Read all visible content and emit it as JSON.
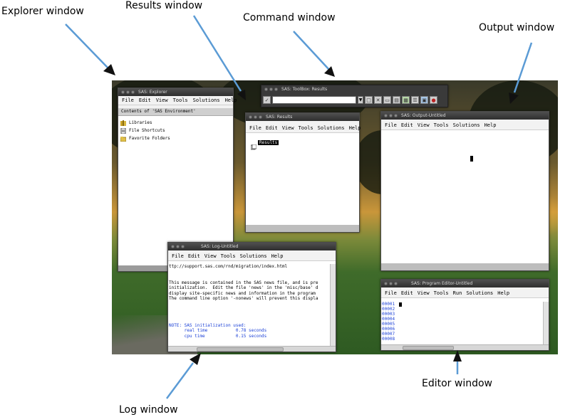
{
  "annotations": {
    "explorer": "Explorer window",
    "results": "Results window",
    "command": "Command window",
    "output": "Output window",
    "log": "Log window",
    "editor": "Editor window"
  },
  "explorer": {
    "title": "SAS: Explorer",
    "menu": [
      "File",
      "Edit",
      "View",
      "Tools",
      "Solutions",
      "Help"
    ],
    "header": "Contents of 'SAS Environment'",
    "items": [
      {
        "label": "Libraries",
        "icon": "library-icon"
      },
      {
        "label": "File Shortcuts",
        "icon": "file-shortcuts-icon"
      },
      {
        "label": "Favorite Folders",
        "icon": "favorite-folders-icon"
      }
    ]
  },
  "toolbox": {
    "title": "SAS: ToolBox: Results",
    "command_value": "",
    "buttons": [
      "checkmark-icon",
      "new-icon",
      "delete-icon",
      "cut-icon",
      "copy-icon",
      "details-icon",
      "list-icon",
      "save-icon",
      "help-icon"
    ]
  },
  "results": {
    "title": "SAS: Results",
    "menu": [
      "File",
      "Edit",
      "View",
      "Tools",
      "Solutions",
      "Help"
    ],
    "item": "Results"
  },
  "output": {
    "title": "SAS: Output-Untitled",
    "menu": [
      "File",
      "Edit",
      "View",
      "Tools",
      "Solutions",
      "Help"
    ]
  },
  "log": {
    "title": "SAS: Log-Untitled",
    "menu": [
      "File",
      "Edit",
      "View",
      "Tools",
      "Solutions",
      "Help"
    ],
    "lines": [
      "ttp://support.sas.com/rnd/migration/index.html",
      "",
      "",
      "This message is contained in the SAS news file, and is pre",
      "initialization.  Edit the file 'news' in the 'misc/base' d",
      "display site-specific news and information in the program",
      "The command line option '-nonews' will prevent this displa"
    ],
    "notes": [
      "NOTE: SAS initialization used:",
      "      real time           0.78 seconds",
      "      cpu time            0.15 seconds"
    ],
    "colors": {
      "text": "#000000",
      "note": "#1a3fd6"
    }
  },
  "editor": {
    "title": "SAS: Program Editor-Untitled",
    "menu": [
      "File",
      "Edit",
      "View",
      "Tools",
      "Run",
      "Solutions",
      "Help"
    ],
    "line_numbers": [
      "00001",
      "00002",
      "00003",
      "00004",
      "00005",
      "00006",
      "00007",
      "00008"
    ],
    "line_number_color": "#1a3fd6"
  }
}
